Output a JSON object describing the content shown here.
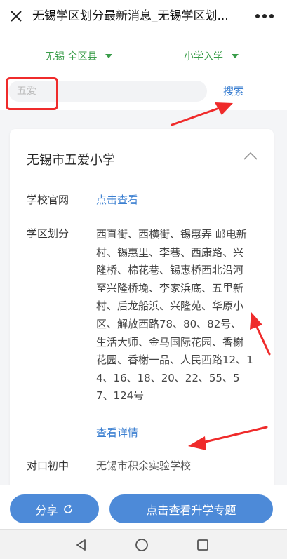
{
  "header": {
    "title": "无锡学区划分最新消息_无锡学区划..."
  },
  "filters": {
    "region": "无锡 全区县",
    "level": "小学入学"
  },
  "search": {
    "placeholder": "五爱",
    "button_label": "搜索"
  },
  "school": {
    "name": "无锡市五爱小学",
    "rows": {
      "website_label": "学校官网",
      "website_link": "点击查看",
      "district_label": "学区划分",
      "district_text": "西直街、西横街、锡惠弄 邮电新村、锡惠里、李巷、西康路、兴隆桥、棉花巷、锡惠桥西北沿河至兴隆桥堍、李家浜底、五里新村、后龙船浜、兴隆苑、华原小区、解放西路78、80、82号、 生活大师、金马国际花园、香榭花园、香榭一品、人民西路12、14、16、18、20、22、55、57、124号",
      "details_link": "查看详情",
      "middle_label": "对口初中",
      "middle_school": "无锡市积余实验学校"
    }
  },
  "actions": {
    "share_label": "分享",
    "promo_label": "点击查看升学专题"
  },
  "colors": {
    "accent_blue": "#4d8ad8",
    "link_blue": "#3b7fd1",
    "filter_green": "#3a9d4a",
    "annotation_red": "#ef2b2b"
  },
  "icons": [
    "close-icon",
    "more-icon",
    "chevron-up-icon",
    "refresh-icon",
    "nav-back-icon",
    "nav-home-icon",
    "nav-recent-icon"
  ]
}
